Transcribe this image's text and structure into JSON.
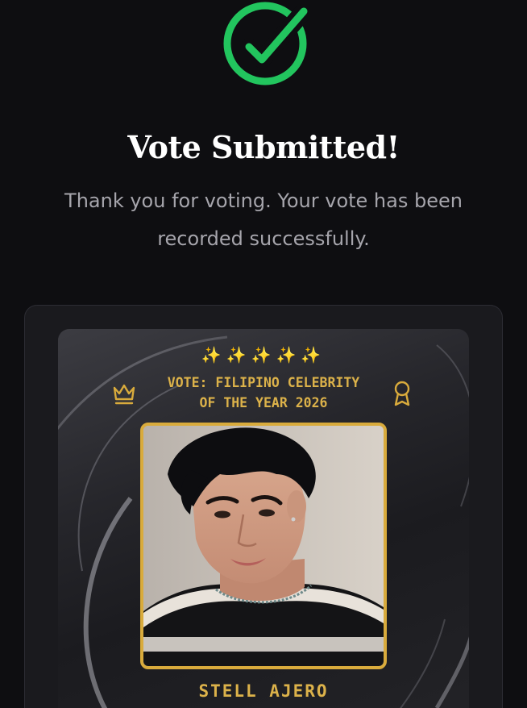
{
  "confirmation": {
    "icon": "check-circle-icon",
    "title": "Vote Submitted!",
    "message": "Thank you for voting. Your vote has been recorded successfully.",
    "accent_color": "#22c55e"
  },
  "vote_card": {
    "sparkles": "✨✨✨✨✨",
    "left_icon": "crown-icon",
    "right_icon": "award-ribbon-icon",
    "category_line1": "VOTE: FILIPINO CELEBRITY",
    "category_line2": "OF THE YEAR 2026",
    "nominee_name": "STELL AJERO",
    "gold_color": "#d9ab3c"
  }
}
